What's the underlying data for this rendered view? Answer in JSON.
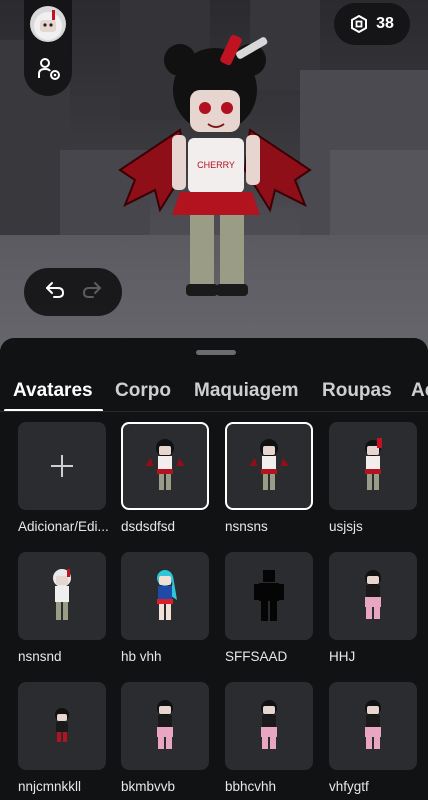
{
  "top_bar": {
    "robux_count": "38"
  },
  "tabs": [
    {
      "label": "Avatares",
      "active": true
    },
    {
      "label": "Corpo",
      "active": false
    },
    {
      "label": "Maquiagem",
      "active": false
    },
    {
      "label": "Roupas",
      "active": false
    },
    {
      "label": "Ac",
      "active": false
    }
  ],
  "avatars": [
    {
      "label": "Adicionar/Edi...",
      "kind": "add",
      "selected": false
    },
    {
      "label": "dsdsdfsd",
      "kind": "vampire",
      "selected": true
    },
    {
      "label": "nsnsns",
      "kind": "vampire",
      "selected": true
    },
    {
      "label": "usjsjs",
      "kind": "vampire",
      "selected": false
    },
    {
      "label": "nsnsnd",
      "kind": "white-hair",
      "selected": false
    },
    {
      "label": "hb vhh",
      "kind": "blue-hair",
      "selected": false
    },
    {
      "label": "SFFSAAD",
      "kind": "black-silhouette",
      "selected": false
    },
    {
      "label": "HHJ",
      "kind": "pink-pants",
      "selected": false
    },
    {
      "label": "nnjcmnkkll",
      "kind": "small-dark",
      "selected": false
    },
    {
      "label": "bkmbvvb",
      "kind": "pink-pants",
      "selected": false
    },
    {
      "label": "bbhcvhh",
      "kind": "pink-pants",
      "selected": false
    },
    {
      "label": "vhfygtf",
      "kind": "pink-pants",
      "selected": false
    }
  ],
  "colors": {
    "background": "#111214",
    "tile": "#2b2c30",
    "accent_red": "#b3121f"
  },
  "icons": {
    "robux": "robux-icon",
    "undo": "undo-icon",
    "redo": "redo-icon",
    "settings": "avatar-settings-icon",
    "add": "plus-icon"
  }
}
